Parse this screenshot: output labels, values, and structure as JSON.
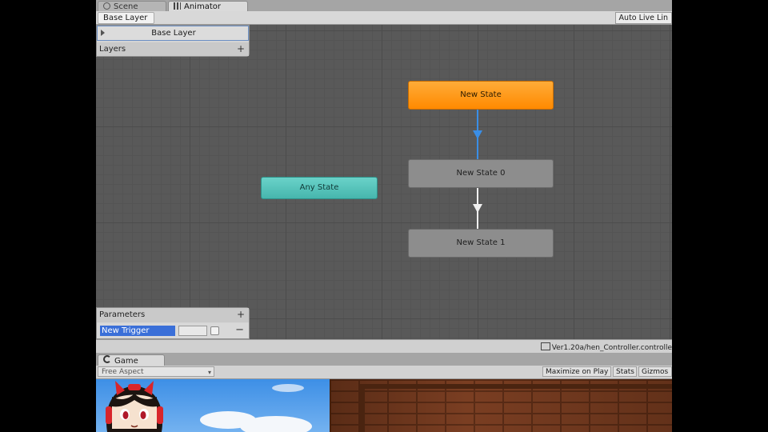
{
  "tabs": {
    "scene": "Scene",
    "animator": "Animator"
  },
  "breadcrumb": "Base Layer",
  "auto_live_link": "Auto Live Lin",
  "layers": {
    "layer_name": "Base Layer",
    "header": "Layers",
    "add": "+"
  },
  "parameters": {
    "header": "Parameters",
    "add": "+",
    "name": "New Trigger",
    "remove": "−"
  },
  "states": {
    "default": "New State",
    "state0": "New State 0",
    "state1": "New State 1",
    "any": "Any State"
  },
  "status_path": "Ver1.20a/hen_Controller.controlle",
  "game": {
    "tab": "Game",
    "aspect": "Free Aspect",
    "maximize": "Maximize on Play",
    "stats": "Stats",
    "gizmos": "Gizmos"
  },
  "colors": {
    "default_state": "#ff8a00",
    "any_state": "#46b6ad",
    "normal_state": "#8d8d8d",
    "selected_transition": "#3a8ee6",
    "selection": "#3a6fd8"
  },
  "icons": {
    "scene_tab": "scene-icon",
    "animator_tab": "animator-icon",
    "game_tab": "game-controller-icon",
    "status": "controller-file-icon"
  }
}
